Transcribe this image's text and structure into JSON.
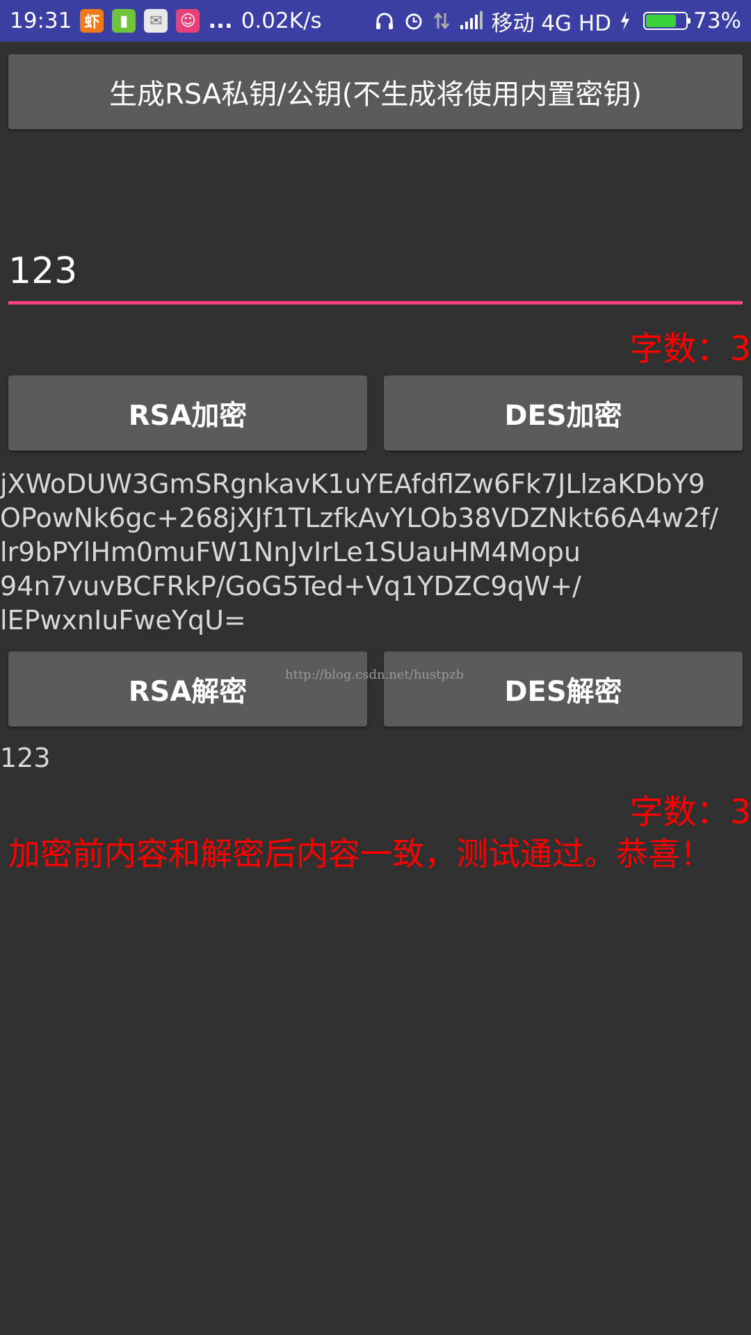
{
  "status_bar": {
    "time": "19:31",
    "dots": "...",
    "net_speed": "0.02K/s",
    "carrier": "移动 4G HD",
    "battery_percent": "73%",
    "battery_level": 0.73,
    "icons": [
      "xiami-icon",
      "battery-app-icon",
      "mail-icon",
      "app-icon",
      "headphone-icon",
      "alarm-icon",
      "data-arrows-icon",
      "signal-icon",
      "charging-icon",
      "battery-icon"
    ]
  },
  "buttons": {
    "generate_keys": "生成RSA私钥/公钥(不生成将使用内置密钥)",
    "rsa_encrypt": "RSA加密",
    "des_encrypt": "DES加密",
    "rsa_decrypt": "RSA解密",
    "des_decrypt": "DES解密"
  },
  "input": {
    "value": "123"
  },
  "count_label_1": "字数：3",
  "cipher_lines": [
    "jXWoDUW3GmSRgnkavK1uYEAfdflZw6Fk7JLlzaKDbY9",
    "OPowNk6gc+268jXJf1TLzfkAvYLOb38VDZNkt66A4w2f/",
    "lr9bPYlHm0muFW1NnJvIrLe1SUauHM4Mopu",
    "94n7vuvBCFRkP/GoG5Ted+Vq1YDZC9qW+/",
    "lEPwxnIuFweYqU="
  ],
  "watermark": "http://blog.csdn.net/hustpzb",
  "decrypted_text": "123",
  "count_label_2": "字数：3",
  "result_message": "加密前内容和解密后内容一致，测试通过。恭喜！",
  "colors": {
    "status_bar": "#3b3fa3",
    "background": "#303030",
    "button": "#5a5a5b",
    "accent_underline": "#ff4081",
    "red_text": "#ff0000"
  }
}
